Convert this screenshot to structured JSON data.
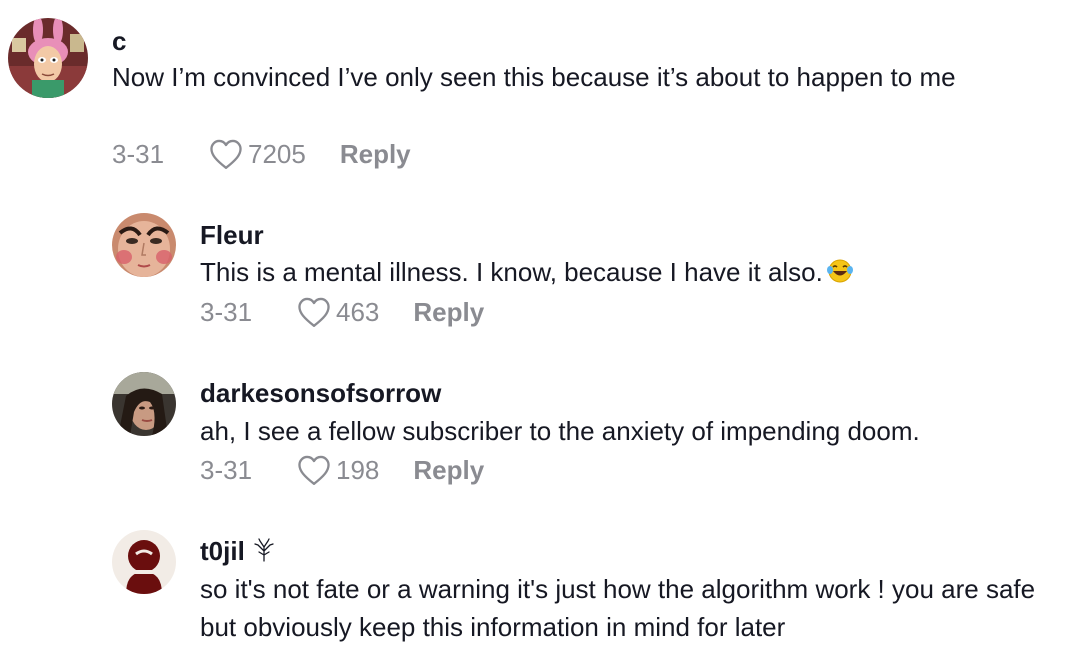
{
  "comments": [
    {
      "username": "c",
      "text": "Now I’m convinced I’ve only seen this because it’s about to happen to me",
      "date": "3-31",
      "likes": "7205",
      "reply_label": "Reply"
    },
    {
      "username": "Fleur",
      "text": "This is a mental illness. I know, because I have it also.",
      "emoji": "face-with-tears-of-joy",
      "date": "3-31",
      "likes": "463",
      "reply_label": "Reply"
    },
    {
      "username": "darkesonsofsorrow",
      "text": "ah, I see a fellow subscriber to the anxiety of impending doom.",
      "date": "3-31",
      "likes": "198",
      "reply_label": "Reply"
    },
    {
      "username": "t0jil",
      "badge_icon": "tree-icon",
      "text": "so it's not fate or a warning it's just how the algorithm work ! you are safe but obviously keep this information in mind for later"
    }
  ],
  "colors": {
    "primary_text": "#161823",
    "secondary_text": "#8a8b91"
  }
}
